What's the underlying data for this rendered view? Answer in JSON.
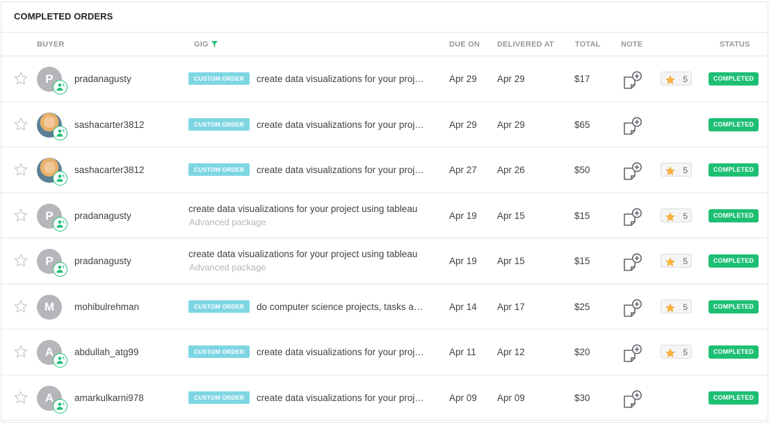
{
  "title": "COMPLETED ORDERS",
  "columns": {
    "buyer": "BUYER",
    "gig": "GIG",
    "due": "DUE ON",
    "delivered": "DELIVERED AT",
    "total": "TOTAL",
    "note": "NOTE",
    "status": "STATUS"
  },
  "colors": {
    "accent": "#1dbf73",
    "custom_tag": "#7fd6e3",
    "star": "#ffb33e"
  },
  "orders": [
    {
      "buyer": "pradanagusty",
      "initial": "P",
      "avatar_photo": false,
      "custom": true,
      "tag": "CUSTOM ORDER",
      "gig": "create data visualizations for your project using tableau",
      "subtitle": "",
      "due": "Apr 29",
      "delivered": "Apr 29",
      "total": "$17",
      "rating": "5",
      "status": "COMPLETED"
    },
    {
      "buyer": "sashacarter3812",
      "initial": "",
      "avatar_photo": true,
      "custom": true,
      "tag": "CUSTOM ORDER",
      "gig": "create data visualizations for your project using tableau",
      "subtitle": "",
      "due": "Apr 29",
      "delivered": "Apr 29",
      "total": "$65",
      "rating": "",
      "status": "COMPLETED"
    },
    {
      "buyer": "sashacarter3812",
      "initial": "",
      "avatar_photo": true,
      "custom": true,
      "tag": "CUSTOM ORDER",
      "gig": "create data visualizations for your project using tableau",
      "subtitle": "",
      "due": "Apr 27",
      "delivered": "Apr 26",
      "total": "$50",
      "rating": "5",
      "status": "COMPLETED"
    },
    {
      "buyer": "pradanagusty",
      "initial": "P",
      "avatar_photo": false,
      "custom": false,
      "tag": "",
      "gig": "create data visualizations for your project using tableau",
      "subtitle": "Advanced package",
      "due": "Apr 19",
      "delivered": "Apr 15",
      "total": "$15",
      "rating": "5",
      "status": "COMPLETED"
    },
    {
      "buyer": "pradanagusty",
      "initial": "P",
      "avatar_photo": false,
      "custom": false,
      "tag": "",
      "gig": "create data visualizations for your project using tableau",
      "subtitle": "Advanced package",
      "due": "Apr 19",
      "delivered": "Apr 15",
      "total": "$15",
      "rating": "5",
      "status": "COMPLETED"
    },
    {
      "buyer": "mohibulrehman",
      "initial": "M",
      "avatar_photo": false,
      "custom": true,
      "tag": "CUSTOM ORDER",
      "gig": "do computer science projects, tasks and assignments",
      "subtitle": "",
      "due": "Apr 14",
      "delivered": "Apr 17",
      "total": "$25",
      "rating": "5",
      "status": "COMPLETED",
      "no_badge": true
    },
    {
      "buyer": "abdullah_atg99",
      "initial": "A",
      "avatar_photo": false,
      "custom": true,
      "tag": "CUSTOM ORDER",
      "gig": "create data visualizations for your project using tableau",
      "subtitle": "",
      "due": "Apr 11",
      "delivered": "Apr 12",
      "total": "$20",
      "rating": "5",
      "status": "COMPLETED"
    },
    {
      "buyer": "amarkulkarni978",
      "initial": "A",
      "avatar_photo": false,
      "custom": true,
      "tag": "CUSTOM ORDER",
      "gig": "create data visualizations for your project using tableau",
      "subtitle": "",
      "due": "Apr 09",
      "delivered": "Apr 09",
      "total": "$30",
      "rating": "",
      "status": "COMPLETED"
    }
  ]
}
